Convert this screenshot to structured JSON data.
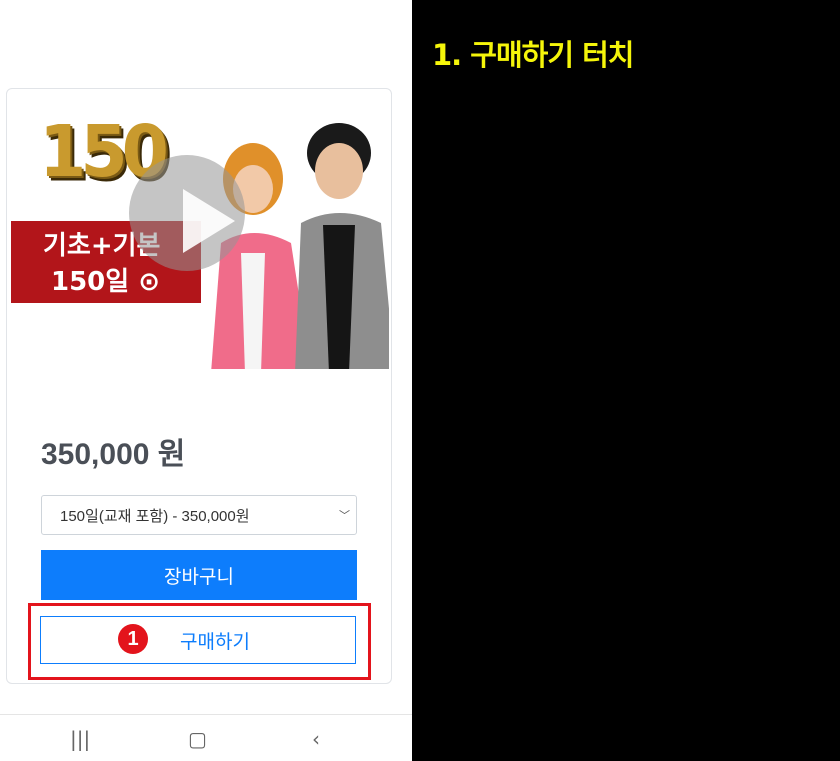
{
  "product": {
    "banner": {
      "number": "150",
      "line1": "기초+기본",
      "line2": "150일"
    },
    "price": "350,000 원",
    "option_select": {
      "value": "150일(교재 포함) - 350,000원"
    },
    "cart_button": "장바구니",
    "buy_button": "구매하기",
    "step_marker": "1"
  },
  "instruction": "1. 구매하기 터치",
  "colors": {
    "primary": "#0d7dfc",
    "highlight": "#e3141c",
    "instruction_text": "#f5f50a",
    "banner_red": "#b2151a"
  },
  "nav": {
    "recent_icon": "recent-apps-icon",
    "home_icon": "home-icon",
    "back_icon": "back-icon"
  }
}
